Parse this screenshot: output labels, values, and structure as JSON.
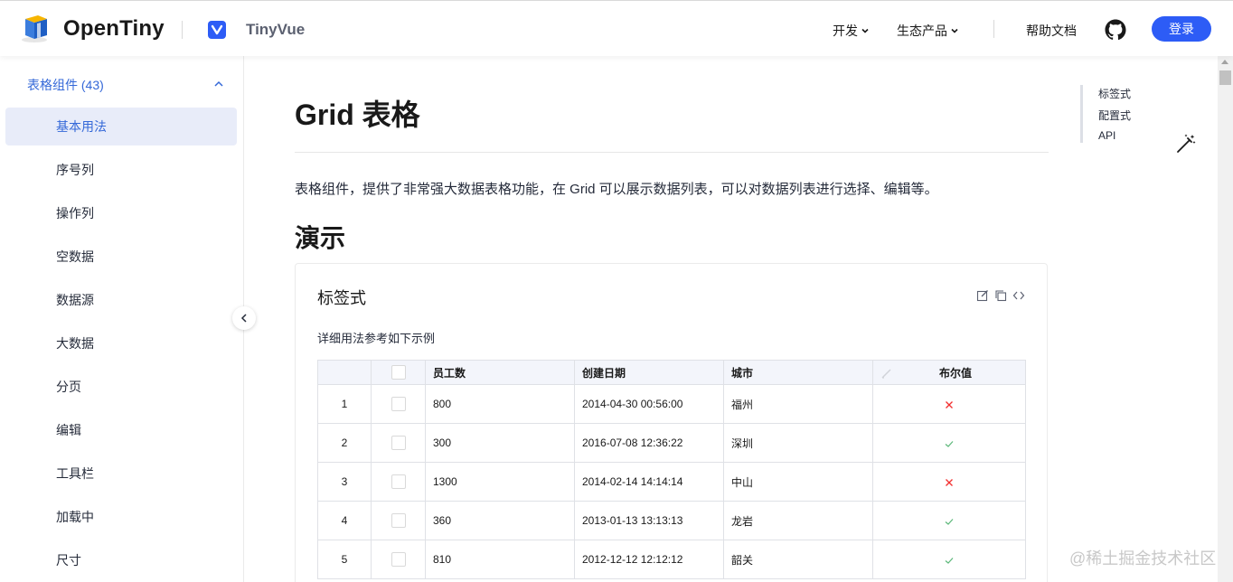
{
  "header": {
    "brand": "OpenTiny",
    "product": "TinyVue",
    "nav": [
      {
        "label": "开发"
      },
      {
        "label": "生态产品"
      }
    ],
    "help_label": "帮助文档",
    "login_label": "登录",
    "accent_color": "#2d5cf6"
  },
  "sidebar": {
    "group_title": "表格组件 (43)",
    "items": [
      {
        "label": "基本用法",
        "active": true
      },
      {
        "label": "序号列"
      },
      {
        "label": "操作列"
      },
      {
        "label": "空数据"
      },
      {
        "label": "数据源"
      },
      {
        "label": "大数据"
      },
      {
        "label": "分页"
      },
      {
        "label": "编辑"
      },
      {
        "label": "工具栏"
      },
      {
        "label": "加载中"
      },
      {
        "label": "尺寸"
      }
    ]
  },
  "main": {
    "title": "Grid 表格",
    "description": "表格组件，提供了非常强大数据表格功能，在 Grid 可以展示数据列表，可以对数据列表进行选择、编辑等。",
    "section_title": "演示",
    "demo": {
      "title": "标签式",
      "description": "详细用法参考如下示例",
      "tools": [
        "edit-icon",
        "copy-icon",
        "code-icon"
      ]
    },
    "grid": {
      "columns": [
        "",
        "",
        "员工数",
        "创建日期",
        "城市",
        "布尔值"
      ],
      "rows": [
        {
          "index": "1",
          "employees": "800",
          "created": "2014-04-30 00:56:00",
          "city": "福州",
          "bool": false
        },
        {
          "index": "2",
          "employees": "300",
          "created": "2016-07-08 12:36:22",
          "city": "深圳",
          "bool": true
        },
        {
          "index": "3",
          "employees": "1300",
          "created": "2014-02-14 14:14:14",
          "city": "中山",
          "bool": false
        },
        {
          "index": "4",
          "employees": "360",
          "created": "2013-01-13 13:13:13",
          "city": "龙岩",
          "bool": true
        },
        {
          "index": "5",
          "employees": "810",
          "created": "2012-12-12 12:12:12",
          "city": "韶关",
          "bool": true
        }
      ]
    }
  },
  "toc": {
    "items": [
      {
        "label": "标签式"
      },
      {
        "label": "配置式"
      },
      {
        "label": "API"
      }
    ]
  },
  "watermark": "@稀土掘金技术社区"
}
